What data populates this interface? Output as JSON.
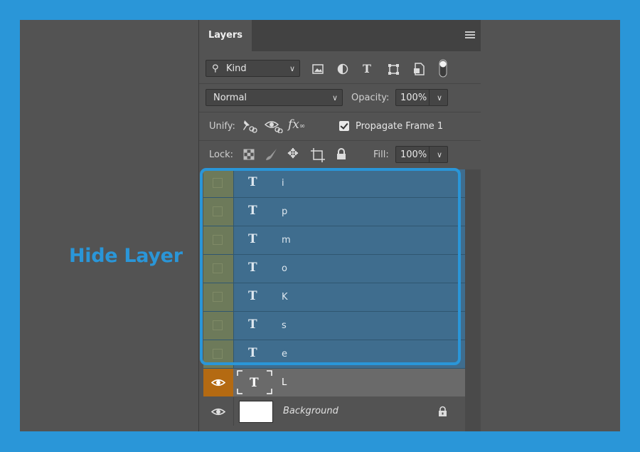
{
  "annotation": {
    "text": "Hide Layer"
  },
  "panel": {
    "tab_label": "Layers",
    "filter": {
      "kind_label": "Kind",
      "icons": [
        "image-filter-icon",
        "adjustment-filter-icon",
        "type-filter-icon",
        "shape-filter-icon",
        "smart-object-filter-icon",
        "filter-toggle-icon"
      ]
    },
    "blend": {
      "mode": "Normal",
      "opacity_label": "Opacity:",
      "opacity_value": "100%"
    },
    "unify": {
      "label": "Unify:",
      "propagate_label": "Propagate Frame 1",
      "propagate_checked": true
    },
    "lock": {
      "label": "Lock:",
      "fill_label": "Fill:",
      "fill_value": "100%"
    },
    "layers": [
      {
        "name": "i",
        "type": "T",
        "visible": false,
        "selected": true
      },
      {
        "name": "p",
        "type": "T",
        "visible": false,
        "selected": true
      },
      {
        "name": "m",
        "type": "T",
        "visible": false,
        "selected": true
      },
      {
        "name": "o",
        "type": "T",
        "visible": false,
        "selected": true
      },
      {
        "name": "K",
        "type": "T",
        "visible": false,
        "selected": true
      },
      {
        "name": "s",
        "type": "T",
        "visible": false,
        "selected": true
      },
      {
        "name": "e",
        "type": "T",
        "visible": false,
        "selected": true
      },
      {
        "name": "L",
        "type": "T",
        "visible": true,
        "selected": false
      },
      {
        "name": "Background",
        "type": "image",
        "visible": true,
        "locked": true
      }
    ]
  },
  "colors": {
    "accent": "#2a96d8",
    "panel_bg": "#535353",
    "selected_layer": "#3f6d8e",
    "eye_active": "#b46a12"
  }
}
